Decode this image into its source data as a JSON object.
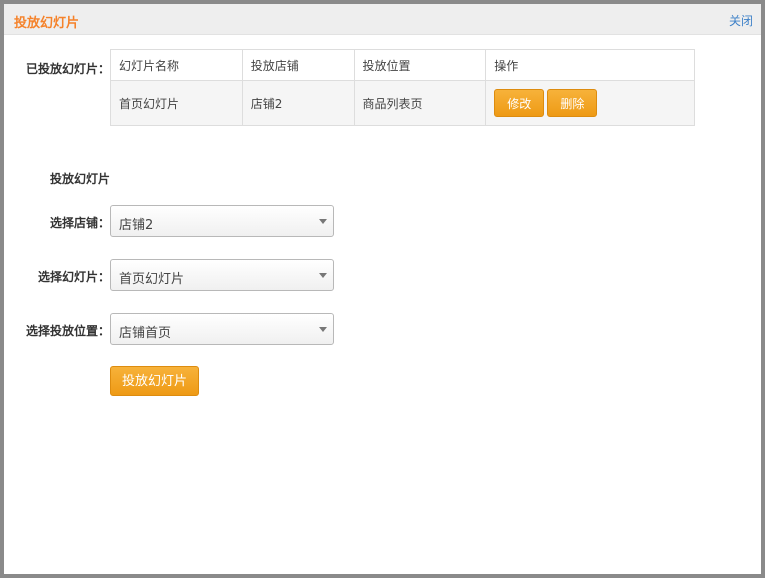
{
  "dialog": {
    "title": "投放幻灯片",
    "close_label": "关闭"
  },
  "placed": {
    "label": "已投放幻灯片：",
    "columns": [
      "幻灯片名称",
      "投放店铺",
      "投放位置",
      "操作"
    ],
    "rows": [
      {
        "name": "首页幻灯片",
        "shop": "店铺2",
        "position": "商品列表页",
        "edit_label": "修改",
        "delete_label": "删除"
      }
    ]
  },
  "form": {
    "section_title": "投放幻灯片",
    "shop_label": "选择店铺：",
    "shop_value": "店铺2",
    "slide_label": "选择幻灯片：",
    "slide_value": "首页幻灯片",
    "position_label": "选择投放位置：",
    "position_value": "店铺首页",
    "submit_label": "投放幻灯片"
  },
  "colors": {
    "accent": "#f5a623",
    "title": "#f5822a",
    "link": "#3f82c8"
  }
}
